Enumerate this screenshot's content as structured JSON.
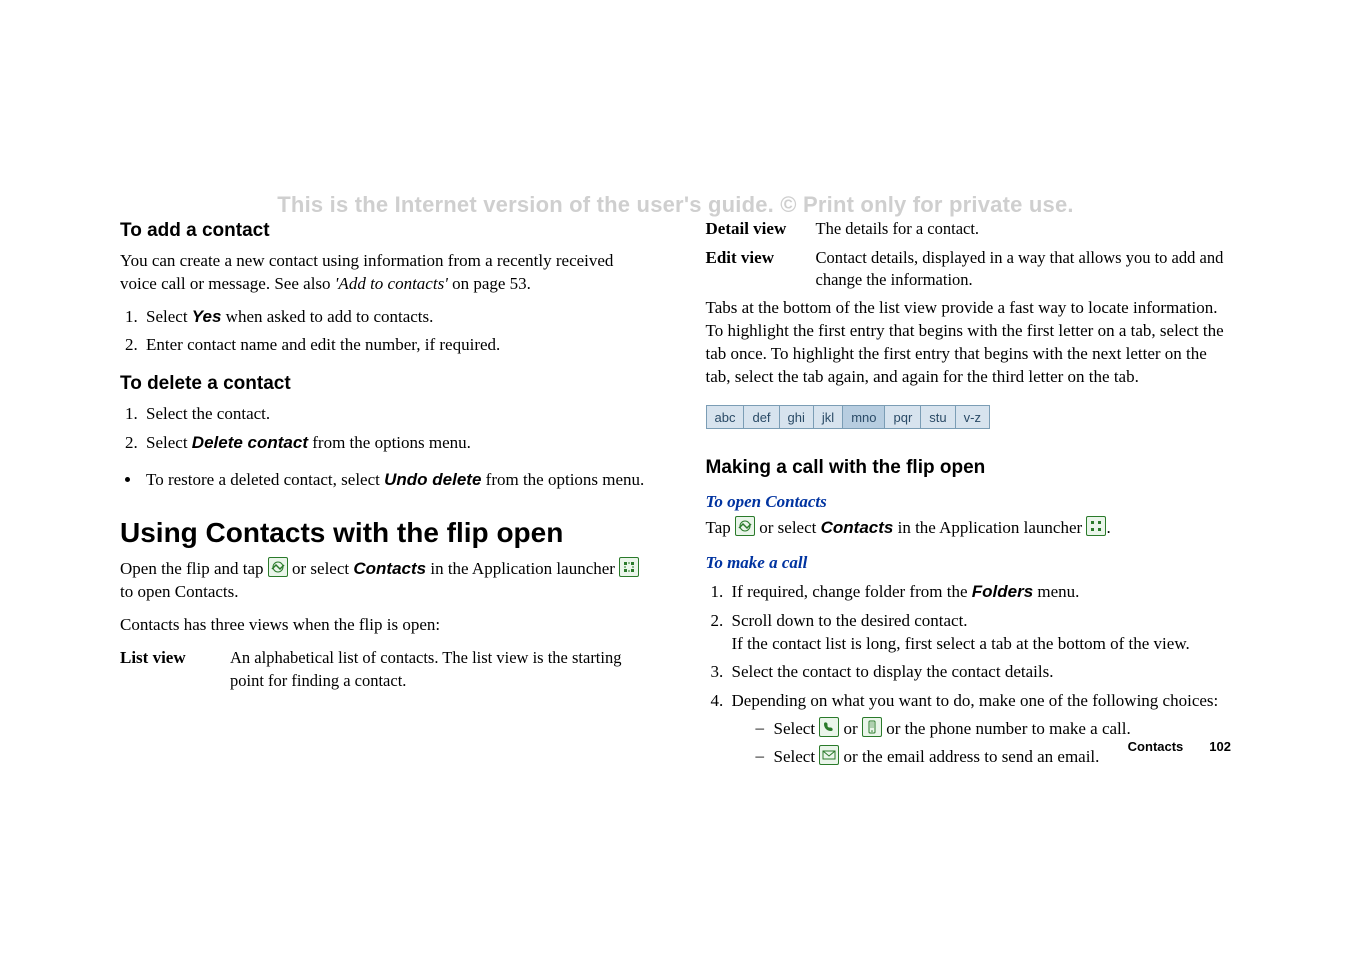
{
  "watermark": "This is the Internet version of the user's guide. © Print only for private use.",
  "left": {
    "h_add": "To add a contact",
    "p_add": "You can create a new contact using information from a recently received voice call or message. See also ",
    "p_add_link": "'Add to contacts'",
    "p_add_tail": " on page 53.",
    "add_steps": {
      "s1a": "Select ",
      "s1b": "Yes",
      "s1c": " when asked to add to contacts.",
      "s2": "Enter contact name and edit the number, if required."
    },
    "h_del": "To delete a contact",
    "del_steps": {
      "s1": "Select the contact.",
      "s2a": "Select ",
      "s2b": "Delete contact",
      "s2c": " from the options menu."
    },
    "del_bullet_a": "To restore a deleted contact, select ",
    "del_bullet_b": "Undo delete",
    "del_bullet_c": " from the options menu.",
    "h_using": "Using Contacts with the flip open",
    "p_open_a": "Open the flip and tap ",
    "p_open_b": "  or select ",
    "p_open_c": "Contacts",
    "p_open_d": " in the Application launcher ",
    "p_open_e": "  to open Contacts.",
    "p_views": "Contacts has three views when the flip is open:",
    "list_term": "List view",
    "list_body": "An alphabetical list of contacts. The list view is the starting point for finding a contact."
  },
  "right": {
    "detail_term": "Detail view",
    "detail_body": "The details for a contact.",
    "edit_term": "Edit view",
    "edit_body": "Contact details, displayed in a way that allows you to add and change the information.",
    "tabs_para": "Tabs at the bottom of the list view provide a fast way to locate information. To highlight the first entry that begins with the first letter on a tab, select the tab once. To highlight the first entry that begins with the next letter on the tab, select the tab again, and again for the third letter on the tab.",
    "tabs": [
      "abc",
      "def",
      "ghi",
      "jkl",
      "mno",
      "pqr",
      "stu",
      "v-z"
    ],
    "h_make": "Making a call with the flip open",
    "h_openc": "To open Contacts",
    "p_tap_a": "Tap ",
    "p_tap_b": " or select ",
    "p_tap_c": "Contacts",
    "p_tap_d": " in the Application launcher ",
    "p_tap_e": ".",
    "h_makecall": "To make a call",
    "mc": {
      "s1a": "If required, change folder from the ",
      "s1b": "Folders",
      "s1c": " menu.",
      "s2a": "Scroll down to the desired contact.",
      "s2b": "If the contact list is long, first select a tab at the bottom of the view.",
      "s3": "Select the contact to display the contact details.",
      "s4": "Depending on what you want to do, make one of the following choices:",
      "d1a": "Select ",
      "d1b": " or ",
      "d1c": " or the phone number to make a call.",
      "d2a": "Select ",
      "d2b": " or the email address to send an email."
    }
  },
  "footer": {
    "section": "Contacts",
    "page": "102"
  }
}
